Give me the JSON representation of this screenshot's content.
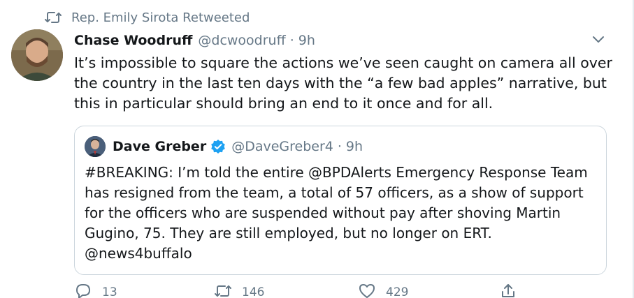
{
  "retweet": {
    "label": "Rep. Emily Sirota Retweeted",
    "icon": "retweet-icon"
  },
  "tweet": {
    "author_name": "Chase Woodruff",
    "author_handle": "@dcwoodruff",
    "separator": "·",
    "time": "9h",
    "text_lines": [
      "It’s impossible to square the actions we’ve seen caught on camera all over",
      "the country in the last ten days with the “a few bad apples” narrative, but",
      "this in particular should bring an end to it once and for all."
    ]
  },
  "quote": {
    "author_name": "Dave Greber",
    "verified": true,
    "author_handle": "@DaveGreber4",
    "separator": "·",
    "time": "9h",
    "text_lines": [
      "#BREAKING: I’m told the entire @BPDAlerts Emergency Response Team",
      "has resigned from the team, a total of 57 officers, as a show of support",
      "for the officers who are suspended without pay after shoving Martin",
      "Gugino, 75. They are still employed, but no longer on ERT.",
      "@news4buffalo"
    ]
  },
  "actions": {
    "reply_count": "13",
    "retweet_count": "146",
    "like_count": "429"
  },
  "colors": {
    "text": "#14171a",
    "secondary": "#657786",
    "border": "#ccd6dd",
    "verified_blue": "#1da1f2"
  }
}
